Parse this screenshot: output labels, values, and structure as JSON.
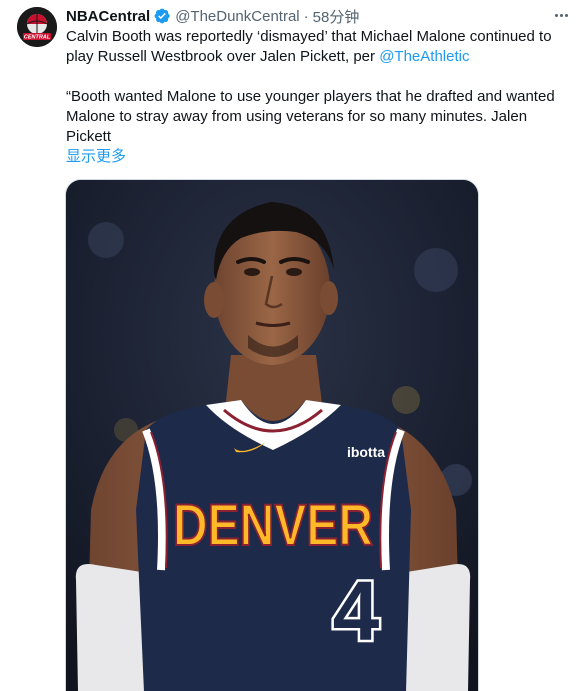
{
  "tweet": {
    "display_name": "NBACentral",
    "handle": "@TheDunkCentral",
    "separator": "·",
    "time": "58分钟",
    "avatar_text": "CENTRAL",
    "line1": "Calvin Booth was reportedly ‘dismayed’ that Michael Malone continued to",
    "line2_prefix": "play Russell Westbrook over Jalen Pickett, per ",
    "line2_mention": "@TheAthletic",
    "quote_line1": "“Booth wanted Malone to use younger players that he drafted and wanted",
    "quote_line2": "Malone to stray away from using veterans for so many minutes. Jalen",
    "quote_line3": "Pickett",
    "show_more": "显示更多"
  },
  "media": {
    "jersey_team": "DENVER",
    "jersey_number": "4",
    "jersey_sponsor": "ibotta",
    "colors": {
      "jersey_navy": "#1e2a4a",
      "jersey_gold": "#fdb927",
      "jersey_red": "#8b2131",
      "skin": "#8a5a3c",
      "background": "#1b2331"
    }
  },
  "colors": {
    "link": "#1d9bf0",
    "text": "#0f1419",
    "secondary": "#536471",
    "verified": "#1d9bf0"
  }
}
